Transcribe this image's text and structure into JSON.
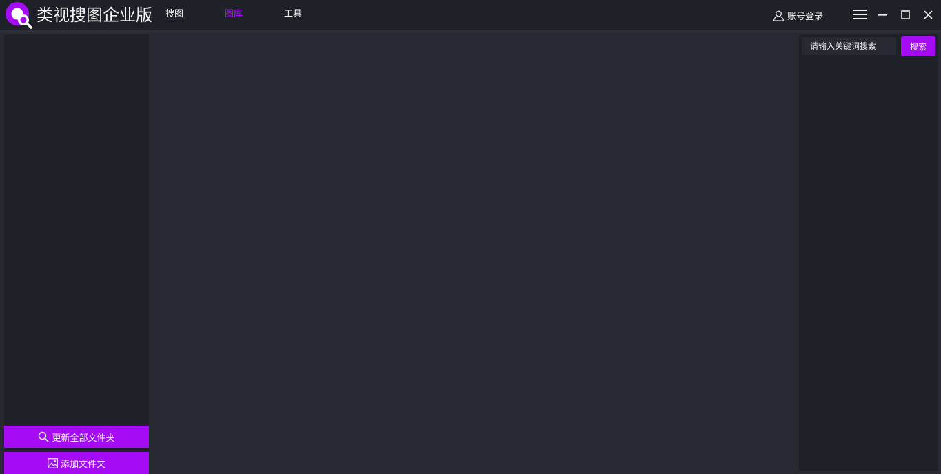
{
  "app": {
    "title": "类视搜图企业版",
    "logo_icon": "magnifier-logo-icon",
    "accent_color": "#a50cf5"
  },
  "nav": {
    "tabs": [
      {
        "label": "搜图",
        "active": false
      },
      {
        "label": "图库",
        "active": true
      },
      {
        "label": "工具",
        "active": false
      }
    ]
  },
  "header": {
    "login_label": "账号登录",
    "login_icon": "user-icon",
    "menu_icon": "hamburger-menu-icon",
    "minimize_icon": "minimize-icon",
    "maximize_icon": "maximize-icon",
    "close_icon": "close-icon"
  },
  "search": {
    "placeholder": "请输入关键词搜索",
    "value": "",
    "button_label": "搜索"
  },
  "left_panel": {
    "refresh_label": "更新全部文件夹",
    "refresh_icon": "search-icon",
    "add_folder_label": "添加文件夹",
    "add_folder_icon": "image-icon"
  }
}
